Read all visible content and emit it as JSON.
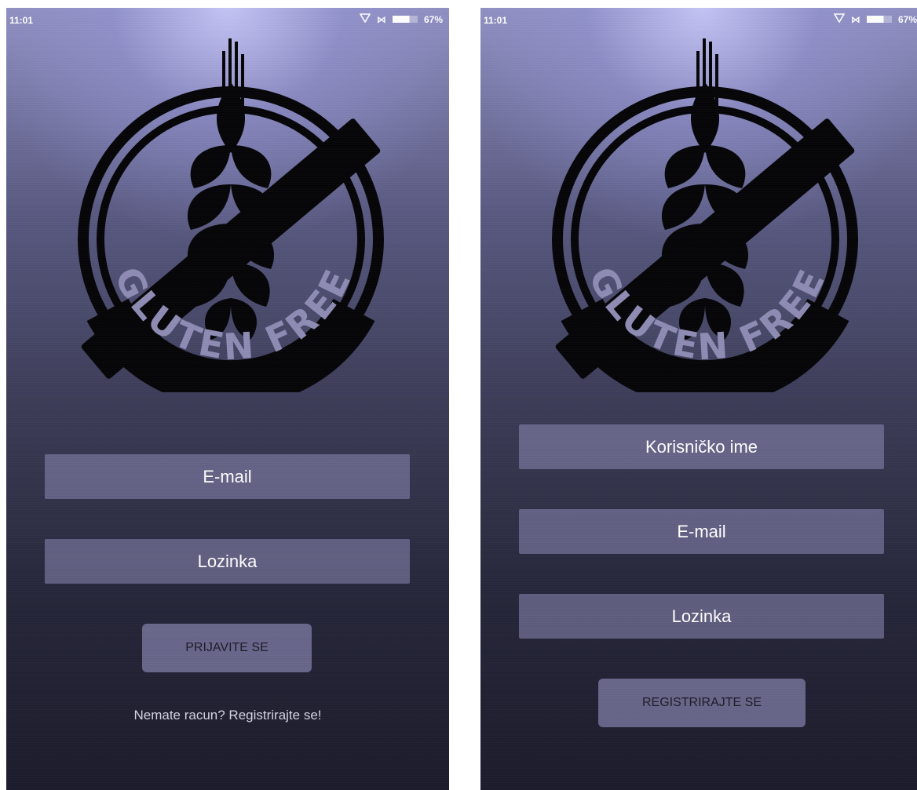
{
  "status_bar": {
    "time": "11:01",
    "battery_percent": "67%",
    "icons": [
      "signal-icon",
      "network-icon",
      "battery-icon"
    ]
  },
  "logo": {
    "text": "GLUTEN FREE"
  },
  "login_screen": {
    "email_placeholder": "E-mail",
    "password_placeholder": "Lozinka",
    "login_button": "PRIJAVITE SE",
    "register_link": "Nemate racun? Registrirajte se!"
  },
  "register_screen": {
    "username_placeholder": "Korisničko ime",
    "email_placeholder": "E-mail",
    "password_placeholder": "Lozinka",
    "register_button": "REGISTRIRAJTE SE"
  },
  "colors": {
    "field_background": "#7d7ba6",
    "button_background": "#827faa",
    "background_top": "#b8b8f0",
    "background_bottom": "#1b1b2b"
  }
}
